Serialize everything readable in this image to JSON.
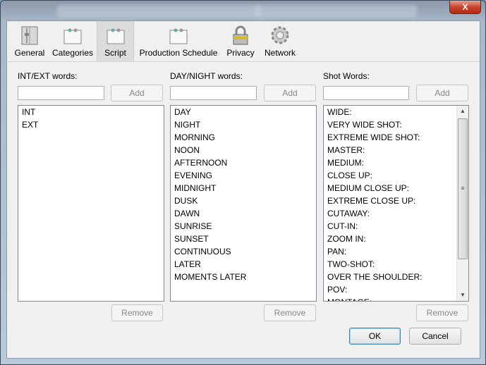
{
  "window": {
    "close_label": "X"
  },
  "toolbar": {
    "tabs": [
      {
        "label": "General",
        "icon": "sliders-icon"
      },
      {
        "label": "Categories",
        "icon": "folder-icon"
      },
      {
        "label": "Script",
        "icon": "folder-icon",
        "selected": true
      },
      {
        "label": "Production Schedule",
        "icon": "folder-icon"
      },
      {
        "label": "Privacy",
        "icon": "lock-icon"
      },
      {
        "label": "Network",
        "icon": "gear-icon"
      }
    ]
  },
  "columns": [
    {
      "label": "INT/EXT words:",
      "input_value": "",
      "add_label": "Add",
      "remove_label": "Remove",
      "items": [
        "INT",
        "EXT"
      ]
    },
    {
      "label": "DAY/NIGHT words:",
      "input_value": "",
      "add_label": "Add",
      "remove_label": "Remove",
      "items": [
        "DAY",
        "NIGHT",
        "MORNING",
        "NOON",
        "AFTERNOON",
        "EVENING",
        "MIDNIGHT",
        "DUSK",
        "DAWN",
        "SUNRISE",
        "SUNSET",
        "CONTINUOUS",
        "LATER",
        "MOMENTS LATER"
      ]
    },
    {
      "label": "Shot Words:",
      "input_value": "",
      "add_label": "Add",
      "remove_label": "Remove",
      "items": [
        "WIDE:",
        "VERY WIDE SHOT:",
        "EXTREME WIDE SHOT:",
        "MASTER:",
        "MEDIUM:",
        "CLOSE UP:",
        "MEDIUM CLOSE UP:",
        "EXTREME CLOSE UP:",
        "CUTAWAY:",
        "CUT-IN:",
        "ZOOM IN:",
        "PAN:",
        "TWO-SHOT:",
        "OVER THE SHOULDER:",
        "POV:",
        "MONTAGE:"
      ]
    }
  ],
  "footer": {
    "ok_label": "OK",
    "cancel_label": "Cancel"
  }
}
